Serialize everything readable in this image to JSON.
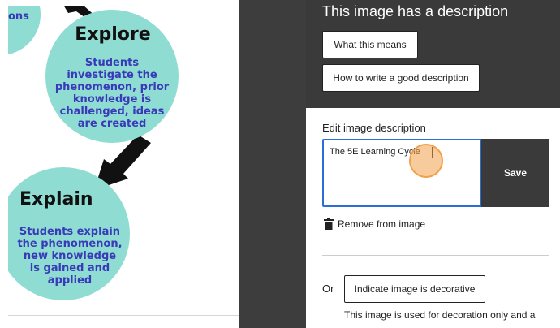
{
  "canvas": {
    "fragment": "ons",
    "explore": {
      "title": "Explore",
      "text": [
        "Students",
        "investigate the",
        "phenomenon, prior",
        "knowledge is",
        "challenged, ideas",
        "are created"
      ]
    },
    "explain": {
      "title": "Explain",
      "text": [
        "Students explain",
        "the phenomenon,",
        "new knowledge",
        "is gained and",
        "applied"
      ]
    }
  },
  "panel": {
    "heading": "This image has a description",
    "what_button": "What this means",
    "how_button": "How to write a good description",
    "edit_label": "Edit image description",
    "description_value": "The 5E Learning Cycle",
    "save_button": "Save",
    "remove_label": "Remove from image",
    "or_label": "Or",
    "decorative_button": "Indicate image is decorative",
    "decorative_note": "This image is used for decoration only and a"
  },
  "colors": {
    "circle": "#8fdcd3",
    "circle_text": "#3a3ab8",
    "panel_dark": "#3a3a3a",
    "cursor": "#f2a04a"
  }
}
